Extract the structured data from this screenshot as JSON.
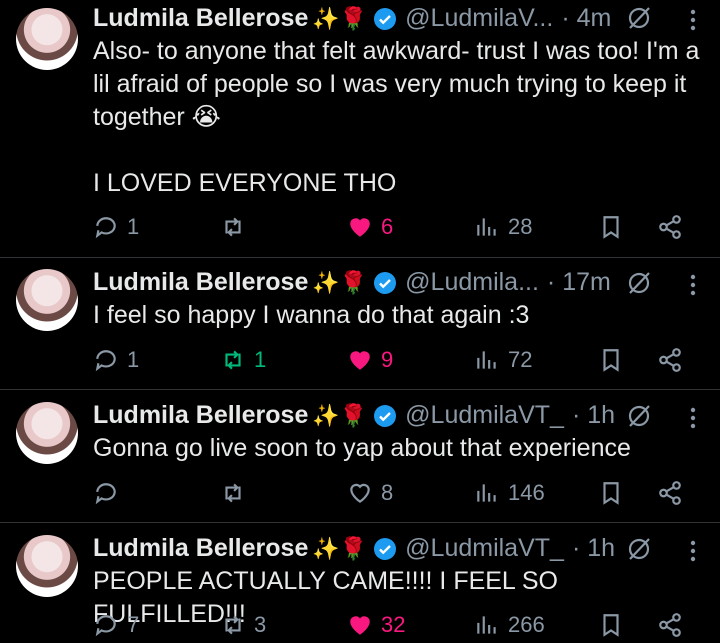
{
  "tweets": [
    {
      "name": "Ludmila Bellerose",
      "emoji": "✨🌹",
      "handle": "@LudmilaV...",
      "time": "· 4m",
      "text": "Also- to anyone that felt awkward- trust I was too! I'm a lil afraid of people so I was very much trying to keep it together 😭\n\nI LOVED EVERYONE THO",
      "replies": "1",
      "retweets": "",
      "likes": "6",
      "views": "28",
      "liked": true,
      "retweeted": false
    },
    {
      "name": "Ludmila Bellerose",
      "emoji": "✨🌹",
      "handle": "@Ludmila...",
      "time": "· 17m",
      "text": "I feel so happy I wanna do that again :3",
      "replies": "1",
      "retweets": "1",
      "likes": "9",
      "views": "72",
      "liked": true,
      "retweeted": true
    },
    {
      "name": "Ludmila Bellerose",
      "emoji": "✨🌹",
      "handle": "@LudmilaVT_",
      "time": "· 1h",
      "text": "Gonna go live soon to yap about that experience",
      "replies": "",
      "retweets": "",
      "likes": "8",
      "views": "146",
      "liked": false,
      "retweeted": false
    },
    {
      "name": "Ludmila Bellerose",
      "emoji": "✨🌹",
      "handle": "@LudmilaVT_",
      "time": "· 1h",
      "text": "PEOPLE ACTUALLY CAME!!!! I FEEL SO FULFILLED!!!",
      "replies": "7",
      "retweets": "3",
      "likes": "32",
      "views": "266",
      "liked": true,
      "retweeted": false
    }
  ],
  "colors": {
    "like": "#f91880",
    "retweet": "#00ba7c",
    "muted": "#8b98a5",
    "verified": "#1d9bf0"
  }
}
